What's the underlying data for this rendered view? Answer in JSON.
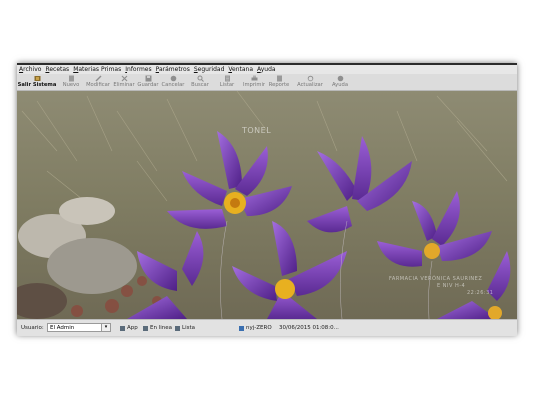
{
  "menubar": {
    "items": [
      "Archivo",
      "Recetas",
      "Materias Primas",
      "Informes",
      "Parámetros",
      "Seguridad",
      "Ventana",
      "Ayuda"
    ]
  },
  "toolbar": {
    "buttons": [
      {
        "label": "Salir Sistema",
        "icon": "exit-icon",
        "active": true
      },
      {
        "label": "Nuevo",
        "icon": "new-icon",
        "active": false
      },
      {
        "label": "Modificar",
        "icon": "edit-icon",
        "active": false
      },
      {
        "label": "Eliminar",
        "icon": "delete-icon",
        "active": false
      },
      {
        "label": "Guardar",
        "icon": "save-icon",
        "active": false
      },
      {
        "label": "Cancelar",
        "icon": "cancel-icon",
        "active": false
      },
      {
        "label": "Buscar",
        "icon": "search-icon",
        "active": false
      },
      {
        "label": "Listar",
        "icon": "list-icon",
        "active": false
      },
      {
        "label": "Imprimir",
        "icon": "print-icon",
        "active": false
      },
      {
        "label": "Reporte",
        "icon": "report-icon",
        "active": false
      },
      {
        "label": "Actualizar",
        "icon": "refresh-icon",
        "active": false
      },
      {
        "label": "Ayuda",
        "icon": "help-icon",
        "active": false
      }
    ]
  },
  "background": {
    "watermark_center": "TONEL",
    "watermark_right_line1": "FARMACIA VERÓNICA SAURINEZ",
    "watermark_right_line2": "E NIV H-4",
    "watermark_right_line3": "22:26:31"
  },
  "statusbar": {
    "user_label": "Usuario:",
    "user_value": "El Admin",
    "app_label": "App",
    "online_label": "En linea",
    "ready_label": "Lista",
    "machine": "nyj-ZERO",
    "datetime": "30/06/2015 01:08:0..."
  },
  "colors": {
    "window_bg": "#d9d9d9",
    "titlebar": "#2b2b2b",
    "flower_purple": "#7a3fb5"
  }
}
